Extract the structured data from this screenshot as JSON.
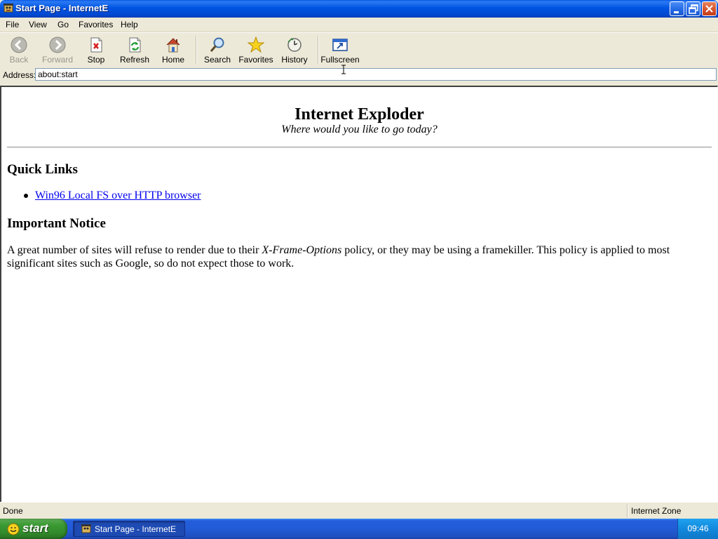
{
  "window": {
    "title": "Start Page - InternetE"
  },
  "menu": [
    "File",
    "View",
    "Go",
    "Favorites",
    "Help"
  ],
  "toolbar": {
    "back": "Back",
    "forward": "Forward",
    "stop": "Stop",
    "refresh": "Refresh",
    "home": "Home",
    "search": "Search",
    "favorites": "Favorites",
    "history": "History",
    "fullscreen": "Fullscreen"
  },
  "address": {
    "label": "Address:",
    "value": "about:start"
  },
  "page": {
    "title": "Internet Exploder",
    "subtitle": "Where would you like to go today?",
    "quick_links_heading": "Quick Links",
    "quick_links": [
      "Win96 Local FS over HTTP browser"
    ],
    "notice_heading": "Important Notice",
    "notice_before": "A great number of sites will refuse to render due to their ",
    "notice_em": "X-Frame-Options",
    "notice_after": " policy, or they may be using a framekiller. This policy is applied to most significant sites such as Google, so do not expect those to work."
  },
  "status": {
    "text": "Done",
    "zone": "Internet Zone"
  },
  "taskbar": {
    "start": "start",
    "task": "Start Page - InternetE",
    "clock": "09:46"
  },
  "colors": {
    "titlebar": "#0054e3",
    "link": "#0000ee",
    "taskbar": "#245edb",
    "start": "#3c9b35"
  }
}
